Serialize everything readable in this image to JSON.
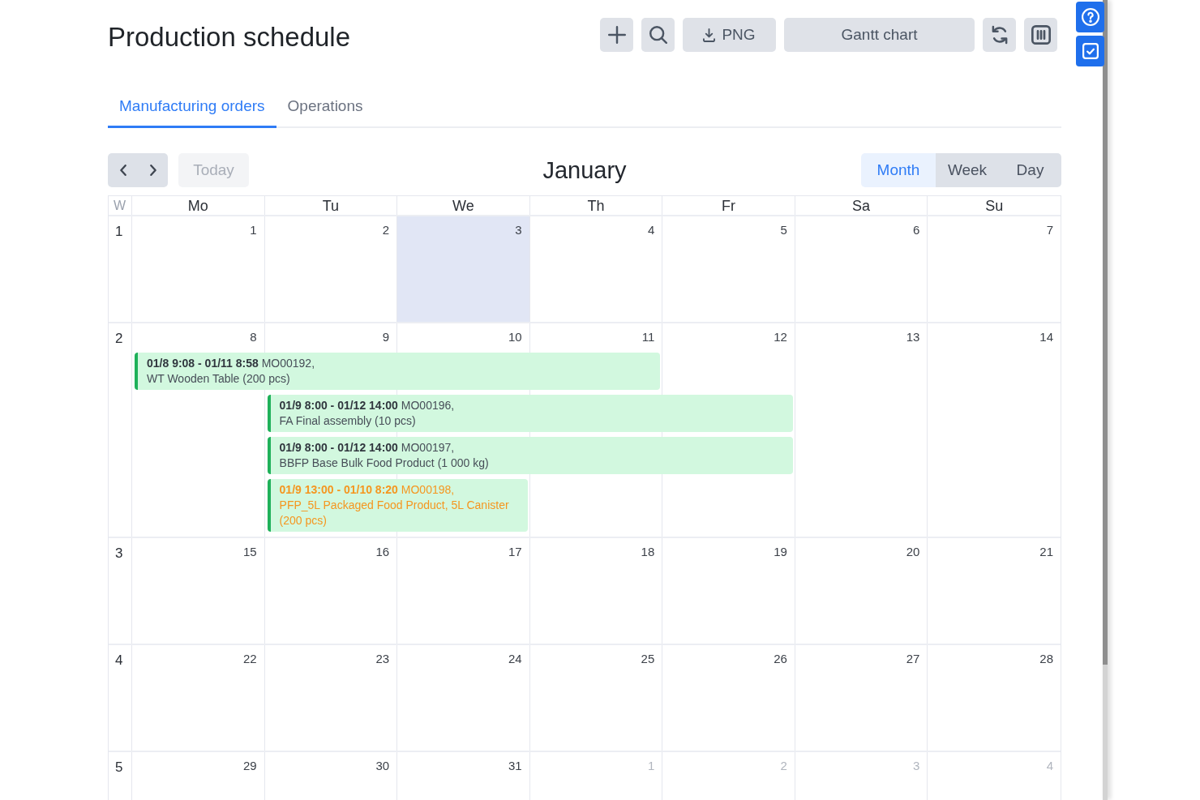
{
  "title": "Production schedule",
  "toolbar": [
    {
      "kind": "add"
    },
    {
      "kind": "search"
    },
    {
      "kind": "export",
      "label": "PNG"
    },
    {
      "kind": "view",
      "label": "Gantt chart"
    },
    {
      "kind": "refresh"
    },
    {
      "kind": "columns"
    }
  ],
  "side_buttons": [
    {
      "kind": "help"
    },
    {
      "kind": "tasks"
    }
  ],
  "tabs": [
    {
      "label": "Manufacturing orders",
      "selected": true
    },
    {
      "label": "Operations",
      "selected": false
    }
  ],
  "navigation": {
    "pager": [
      {
        "kind": "previous"
      },
      {
        "kind": "next"
      }
    ],
    "today": {
      "label": "Today",
      "disabled": true
    },
    "month": "January",
    "views": [
      {
        "label": "Month",
        "selected": true
      },
      {
        "label": "Week",
        "selected": false
      },
      {
        "label": "Day",
        "selected": false
      }
    ]
  },
  "calendar": {
    "week_header": "W",
    "weekdays": [
      "Mo",
      "Tu",
      "We",
      "Th",
      "Fr",
      "Sa",
      "Su"
    ],
    "weeks": [
      {
        "number": "1",
        "days": [
          {
            "date": "1",
            "today": false,
            "outside": false
          },
          {
            "date": "2",
            "today": false,
            "outside": false
          },
          {
            "date": "3",
            "today": true,
            "outside": false
          },
          {
            "date": "4",
            "today": false,
            "outside": false
          },
          {
            "date": "5",
            "today": false,
            "outside": false
          },
          {
            "date": "6",
            "today": false,
            "outside": false
          },
          {
            "date": "7",
            "today": false,
            "outside": false
          }
        ]
      },
      {
        "number": "2",
        "days": [
          {
            "date": "8",
            "today": false,
            "outside": false
          },
          {
            "date": "9",
            "today": false,
            "outside": false
          },
          {
            "date": "10",
            "today": false,
            "outside": false
          },
          {
            "date": "11",
            "today": false,
            "outside": false
          },
          {
            "date": "12",
            "today": false,
            "outside": false
          },
          {
            "date": "13",
            "today": false,
            "outside": false
          },
          {
            "date": "14",
            "today": false,
            "outside": false
          }
        ],
        "events": [
          {
            "heading": "**01/8 9:08 - 01/11 8:58** MO00192,",
            "product": "WT Wooden Table (200 pcs)",
            "warning": false
          },
          {
            "heading": "**01/9 8:00 - 01/12 14:00** MO00196,",
            "product": "FA Final assembly (10 pcs)",
            "warning": false
          },
          {
            "heading": "**01/9 8:00 - 01/12 14:00** MO00197,",
            "product": "BBFP Base Bulk Food Product (1 000 kg)",
            "warning": false
          },
          {
            "heading": "**01/9 13:00 - 01/10 8:20** MO00198,",
            "product": "PFP_5L Packaged Food Product, 5L Canister (200 pcs)",
            "warning": true
          }
        ]
      },
      {
        "number": "3",
        "days": [
          {
            "date": "15",
            "today": false,
            "outside": false
          },
          {
            "date": "16",
            "today": false,
            "outside": false
          },
          {
            "date": "17",
            "today": false,
            "outside": false
          },
          {
            "date": "18",
            "today": false,
            "outside": false
          },
          {
            "date": "19",
            "today": false,
            "outside": false
          },
          {
            "date": "20",
            "today": false,
            "outside": false
          },
          {
            "date": "21",
            "today": false,
            "outside": false
          }
        ]
      },
      {
        "number": "4",
        "days": [
          {
            "date": "22",
            "today": false,
            "outside": false
          },
          {
            "date": "23",
            "today": false,
            "outside": false
          },
          {
            "date": "24",
            "today": false,
            "outside": false
          },
          {
            "date": "25",
            "today": false,
            "outside": false
          },
          {
            "date": "26",
            "today": false,
            "outside": false
          },
          {
            "date": "27",
            "today": false,
            "outside": false
          },
          {
            "date": "28",
            "today": false,
            "outside": false
          }
        ]
      },
      {
        "number": "5",
        "days": [
          {
            "date": "29",
            "today": false,
            "outside": false
          },
          {
            "date": "30",
            "today": false,
            "outside": false
          },
          {
            "date": "31",
            "today": false,
            "outside": false
          },
          {
            "date": "1",
            "today": false,
            "outside": true
          },
          {
            "date": "2",
            "today": false,
            "outside": true
          },
          {
            "date": "3",
            "today": false,
            "outside": true
          },
          {
            "date": "4",
            "today": false,
            "outside": true
          }
        ]
      }
    ]
  }
}
